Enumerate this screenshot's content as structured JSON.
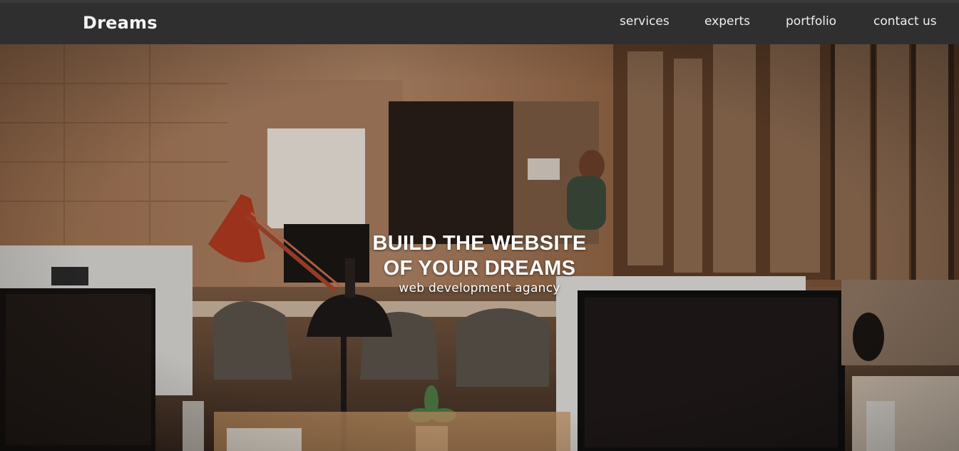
{
  "navbar": {
    "brand": "Dreams",
    "links": [
      {
        "label": "services"
      },
      {
        "label": "experts"
      },
      {
        "label": "portfolio"
      },
      {
        "label": "contact us"
      }
    ]
  },
  "hero": {
    "title_line1": "BUILD THE WEBSITE",
    "title_line2": "OF YOUR DREAMS",
    "subtitle": "web development agancy"
  },
  "colors": {
    "navbar_bg": "#2f2f2f",
    "hero_text": "#ffffff"
  }
}
